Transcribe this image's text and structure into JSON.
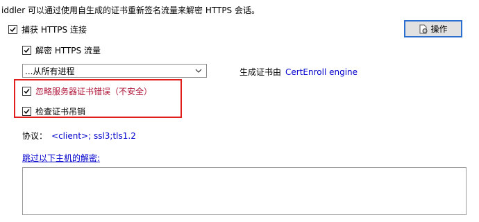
{
  "intro_text": "iddler 可以通过使用自生成的证书重新签名流量来解密 HTTPS 会话。",
  "capture_https": {
    "label": "捕获 HTTPS 连接",
    "checked": true
  },
  "decrypt_https": {
    "label": "解密 HTTPS 流量",
    "checked": true
  },
  "process_filter": {
    "selected": "...从所有进程"
  },
  "cert_generator": {
    "label": "生成证书由",
    "value": "CertEnroll engine"
  },
  "ignore_errors": {
    "label": "忽略服务器证书错误（不安全）",
    "checked": true
  },
  "check_revocation": {
    "label": "检查证书吊销",
    "checked": true
  },
  "protocols": {
    "label": "协议：",
    "value": "<client>; ssl3;tls1.2"
  },
  "skip_hosts": {
    "link_label": "跳过以下主机的解密:",
    "value": ""
  },
  "actions_button": {
    "label": "操作"
  },
  "colors": {
    "link": "#0000cc",
    "warning_text": "#b0193c",
    "highlight_border": "#e01e1e",
    "button_focus_border": "#2b6fd1"
  },
  "icons": {
    "checkbox_check": "check-icon",
    "dropdown": "chevron-down-icon",
    "actions": "gear-document-icon"
  }
}
